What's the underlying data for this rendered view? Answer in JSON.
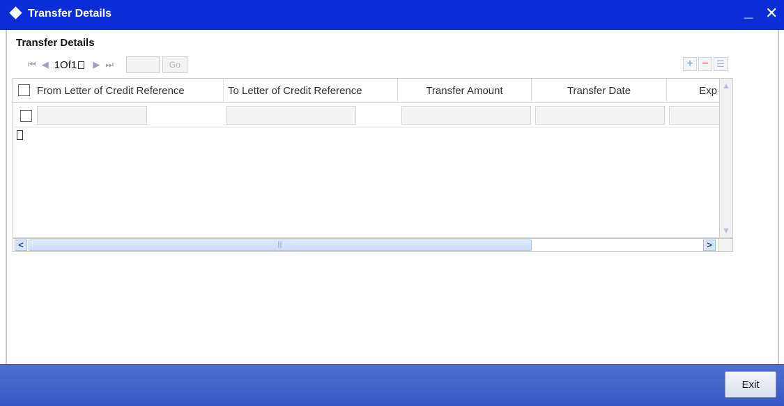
{
  "window": {
    "title": "Transfer Details",
    "minimize_glyph": "_",
    "close_glyph": "✕"
  },
  "section": {
    "title": "Transfer Details"
  },
  "pager": {
    "first_glyph": "⏮",
    "prev_glyph": "◀",
    "count_label": "1Of1",
    "next_glyph": "▶",
    "last_glyph": "⏭",
    "page_value": "",
    "go_label": "Go"
  },
  "toolbar": {
    "add_glyph": "+",
    "remove_glyph": "−",
    "view_glyph": "☰"
  },
  "grid": {
    "columns": [
      "From Letter of Credit Reference",
      "To Letter of Credit Reference",
      "Transfer Amount",
      "Transfer Date",
      "Exp"
    ],
    "rows": [
      {
        "from_ref": "",
        "to_ref": "",
        "amount": "",
        "date": "",
        "exp": ""
      }
    ]
  },
  "scrollbars": {
    "left_glyph": "<",
    "right_glyph": ">",
    "up_glyph": "▲",
    "down_glyph": "▼",
    "thumb_grip": "|||"
  },
  "footer": {
    "exit_label": "Exit"
  },
  "colors": {
    "title_bar": "#0a2dd8",
    "footer": "#3f5fcb"
  }
}
